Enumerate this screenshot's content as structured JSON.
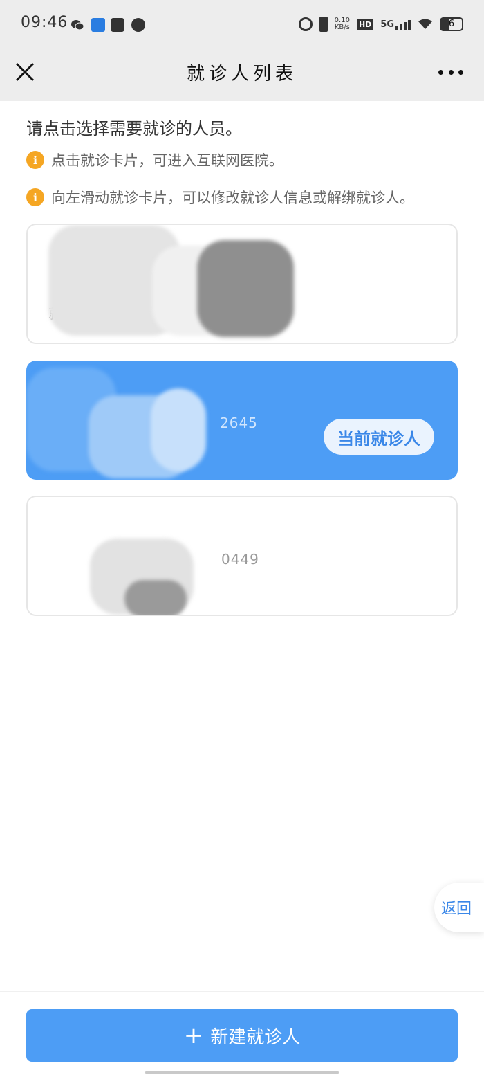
{
  "status_bar": {
    "time": "09:46",
    "net_speed_value": "0.10",
    "net_speed_unit": "KB/s",
    "hd": "HD",
    "network": "5G",
    "battery": "6",
    "icons": [
      "wechat-icon",
      "calculator-icon",
      "play-icon",
      "chat-icon",
      "alarm-icon",
      "vibrate-icon",
      "signal-icon",
      "wifi-icon",
      "battery-icon"
    ]
  },
  "header": {
    "title": "就诊人列表",
    "close_icon": "close-icon",
    "more_icon": "more-icon"
  },
  "instructions": {
    "main": "请点击选择需要就诊的人员。",
    "tips": [
      "点击就诊卡片，可进入互联网医院。",
      "向左滑动就诊卡片，可以修改就诊人信息或解绑就诊人。"
    ],
    "tip_icon": "i"
  },
  "patients": [
    {
      "name": "",
      "label": "就诊",
      "id_suffix": "37",
      "current": false
    },
    {
      "name": "",
      "label": "",
      "id_suffix": "2645",
      "current": true,
      "badge": "当前就诊人"
    },
    {
      "name": "",
      "label": "",
      "id_suffix": "0449",
      "current": false
    }
  ],
  "float_back": {
    "label": "返回"
  },
  "footer": {
    "add_button": "新建就诊人",
    "add_icon": "+"
  },
  "colors": {
    "primary": "#4d9df5",
    "warning": "#f5a623",
    "header_bg": "#ededed"
  }
}
